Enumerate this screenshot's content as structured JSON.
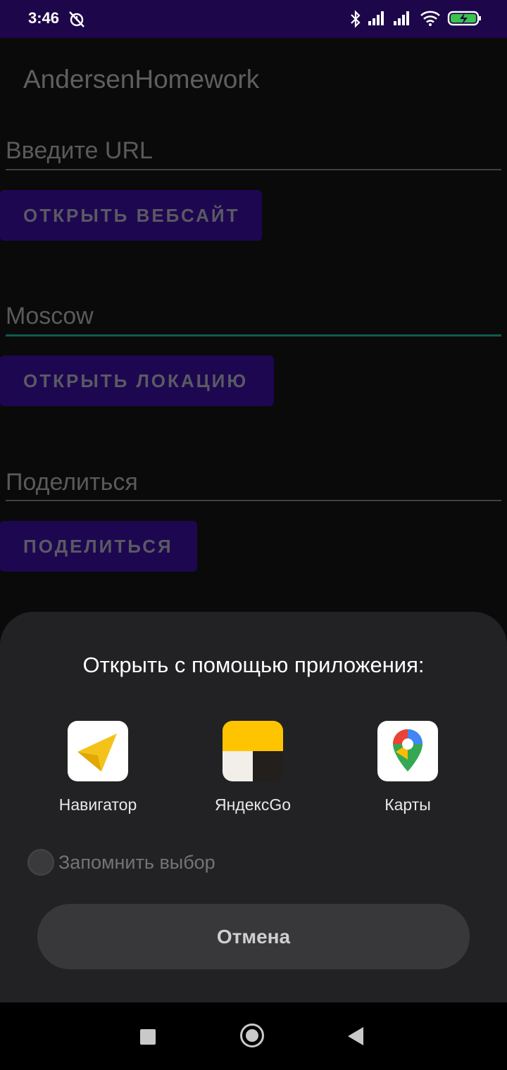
{
  "status_bar": {
    "time": "3:46"
  },
  "app": {
    "title": "AndersenHomework",
    "url_field": {
      "placeholder": "Введите URL"
    },
    "open_website_button": "ОТКРЫТЬ ВЕБСАЙТ",
    "location_field": {
      "value": "Moscow"
    },
    "open_location_button": "ОТКРЫТЬ ЛОКАЦИЮ",
    "share_field": {
      "placeholder": "Поделиться"
    },
    "share_button": "ПОДЕЛИТЬСЯ"
  },
  "chooser": {
    "title": "Открыть с помощью приложения:",
    "apps": [
      {
        "label": "Навигатор",
        "icon": "yandex-navigator-icon"
      },
      {
        "label": "ЯндексGo",
        "icon": "yandex-go-icon"
      },
      {
        "label": "Карты",
        "icon": "google-maps-icon"
      }
    ],
    "remember_label": "Запомнить выбор",
    "cancel_label": "Отмена"
  },
  "colors": {
    "status_bar": "#1d0649",
    "button": "#1e0751",
    "sheet": "#222224",
    "active_underline": "#0e5a52"
  }
}
